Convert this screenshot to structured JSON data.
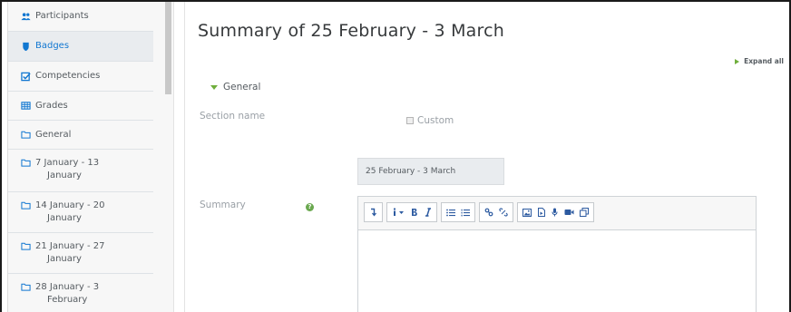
{
  "sidebar": {
    "items": [
      {
        "label": "Participants",
        "label2": "",
        "icon": "users-icon"
      },
      {
        "label": "Badges",
        "label2": "",
        "icon": "shield-icon",
        "active": true
      },
      {
        "label": "Competencies",
        "label2": "",
        "icon": "check-square-icon"
      },
      {
        "label": "Grades",
        "label2": "",
        "icon": "table-icon"
      },
      {
        "label": "General",
        "label2": "",
        "icon": "folder-icon"
      },
      {
        "label": "7 January - 13",
        "label2": "January",
        "icon": "folder-icon"
      },
      {
        "label": "14 January - 20",
        "label2": "January",
        "icon": "folder-icon"
      },
      {
        "label": "21 January - 27",
        "label2": "January",
        "icon": "folder-icon"
      },
      {
        "label": "28 January - 3",
        "label2": "February",
        "icon": "folder-icon"
      }
    ]
  },
  "main": {
    "title": "Summary of 25 February - 3 March",
    "expand_all": "Expand all",
    "section": "General",
    "section_name_label": "Section name",
    "custom_label": "Custom",
    "section_name_value": "25 February - 3 March",
    "summary_label": "Summary"
  },
  "toolbar": {
    "buttons": [
      "collapse",
      "info",
      "bold",
      "italic",
      "bullet-list",
      "numbered-list",
      "link",
      "unlink",
      "image",
      "media",
      "record-audio",
      "record-video",
      "manage-files"
    ]
  },
  "colors": {
    "accent_green": "#6fae3c",
    "link_blue": "#1177d1",
    "sidebar_bg": "#f7f7f7"
  }
}
